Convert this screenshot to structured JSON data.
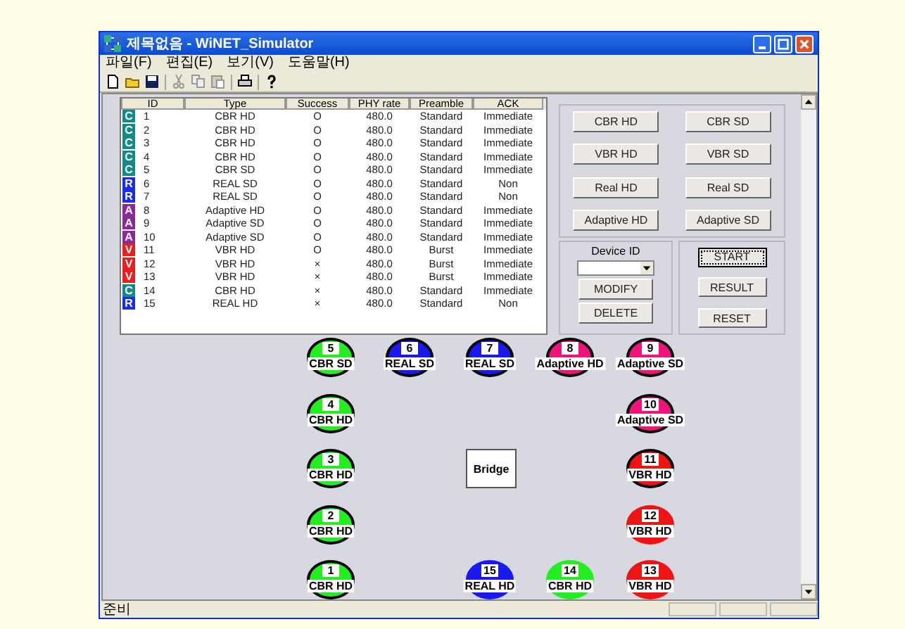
{
  "window": {
    "title": "제목없음 - WiNET_Simulator"
  },
  "menu": [
    "파일(F)",
    "편집(E)",
    "보기(V)",
    "도움말(H)"
  ],
  "table": {
    "columns": [
      "ID",
      "Type",
      "Success",
      "PHY rate",
      "Preamble",
      "ACK"
    ],
    "rows": [
      {
        "badge": "C",
        "color": "#138a8a",
        "id": "1",
        "type": "CBR HD",
        "success": "O",
        "rate": "480.0",
        "preamble": "Standard",
        "ack": "Immediate"
      },
      {
        "badge": "C",
        "color": "#138a8a",
        "id": "2",
        "type": "CBR HD",
        "success": "O",
        "rate": "480.0",
        "preamble": "Standard",
        "ack": "Immediate"
      },
      {
        "badge": "C",
        "color": "#138a8a",
        "id": "3",
        "type": "CBR HD",
        "success": "O",
        "rate": "480.0",
        "preamble": "Standard",
        "ack": "Immediate"
      },
      {
        "badge": "C",
        "color": "#138a8a",
        "id": "4",
        "type": "CBR HD",
        "success": "O",
        "rate": "480.0",
        "preamble": "Standard",
        "ack": "Immediate"
      },
      {
        "badge": "C",
        "color": "#138a8a",
        "id": "5",
        "type": "CBR SD",
        "success": "O",
        "rate": "480.0",
        "preamble": "Standard",
        "ack": "Immediate"
      },
      {
        "badge": "R",
        "color": "#1a2ee8",
        "id": "6",
        "type": "REAL SD",
        "success": "O",
        "rate": "480.0",
        "preamble": "Standard",
        "ack": "Non"
      },
      {
        "badge": "R",
        "color": "#1a2ee8",
        "id": "7",
        "type": "REAL SD",
        "success": "O",
        "rate": "480.0",
        "preamble": "Standard",
        "ack": "Non"
      },
      {
        "badge": "A",
        "color": "#8a2a9a",
        "id": "8",
        "type": "Adaptive HD",
        "success": "O",
        "rate": "480.0",
        "preamble": "Standard",
        "ack": "Immediate"
      },
      {
        "badge": "A",
        "color": "#8a2a9a",
        "id": "9",
        "type": "Adaptive SD",
        "success": "O",
        "rate": "480.0",
        "preamble": "Standard",
        "ack": "Immediate"
      },
      {
        "badge": "A",
        "color": "#8a2a9a",
        "id": "10",
        "type": "Adaptive SD",
        "success": "O",
        "rate": "480.0",
        "preamble": "Standard",
        "ack": "Immediate"
      },
      {
        "badge": "V",
        "color": "#ee1c1c",
        "id": "11",
        "type": "VBR HD",
        "success": "O",
        "rate": "480.0",
        "preamble": "Burst",
        "ack": "Immediate"
      },
      {
        "badge": "V",
        "color": "#ee1c1c",
        "id": "12",
        "type": "VBR HD",
        "success": "×",
        "rate": "480.0",
        "preamble": "Burst",
        "ack": "Immediate"
      },
      {
        "badge": "V",
        "color": "#ee1c1c",
        "id": "13",
        "type": "VBR HD",
        "success": "×",
        "rate": "480.0",
        "preamble": "Burst",
        "ack": "Immediate"
      },
      {
        "badge": "C",
        "color": "#138a8a",
        "id": "14",
        "type": "CBR HD",
        "success": "×",
        "rate": "480.0",
        "preamble": "Standard",
        "ack": "Immediate"
      },
      {
        "badge": "R",
        "color": "#1a2ee8",
        "id": "15",
        "type": "REAL HD",
        "success": "×",
        "rate": "480.0",
        "preamble": "Standard",
        "ack": "Non"
      }
    ]
  },
  "type_buttons": [
    "CBR HD",
    "CBR SD",
    "VBR HD",
    "VBR SD",
    "Real HD",
    "Real SD",
    "Adaptive HD",
    "Adaptive SD"
  ],
  "device": {
    "label": "Device ID",
    "buttons": [
      "MODIFY",
      "DELETE"
    ]
  },
  "control_buttons": [
    {
      "label": "START",
      "focused": true
    },
    {
      "label": "RESULT",
      "focused": false
    },
    {
      "label": "RESET",
      "focused": false
    }
  ],
  "nodes": [
    {
      "id": "5",
      "label": "CBR SD",
      "color": "#22ee22",
      "outlined": true
    },
    {
      "id": "6",
      "label": "REAL SD",
      "color": "#1a1aee",
      "outlined": true
    },
    {
      "id": "7",
      "label": "REAL SD",
      "color": "#1a1aee",
      "outlined": true
    },
    {
      "id": "8",
      "label": "Adaptive HD",
      "color": "#f0147a",
      "outlined": true
    },
    {
      "id": "9",
      "label": "Adaptive SD",
      "color": "#f0147a",
      "outlined": true
    },
    {
      "id": "4",
      "label": "CBR HD",
      "color": "#22ee22",
      "outlined": true
    },
    {
      "id": "10",
      "label": "Adaptive SD",
      "color": "#f0147a",
      "outlined": true
    },
    {
      "id": "3",
      "label": "CBR HD",
      "color": "#22ee22",
      "outlined": true
    },
    {
      "id": "11",
      "label": "VBR HD",
      "color": "#ee1414",
      "outlined": true
    },
    {
      "id": "2",
      "label": "CBR HD",
      "color": "#22ee22",
      "outlined": true
    },
    {
      "id": "12",
      "label": "VBR HD",
      "color": "#ee1414",
      "outlined": false
    },
    {
      "id": "1",
      "label": "CBR HD",
      "color": "#22ee22",
      "outlined": true
    },
    {
      "id": "15",
      "label": "REAL HD",
      "color": "#1a1aee",
      "outlined": false
    },
    {
      "id": "14",
      "label": "CBR HD",
      "color": "#22ee22",
      "outlined": false
    },
    {
      "id": "13",
      "label": "VBR HD",
      "color": "#ee1414",
      "outlined": false
    }
  ],
  "bridge": {
    "label": "Bridge"
  },
  "status_bar": {
    "text": "준비"
  }
}
